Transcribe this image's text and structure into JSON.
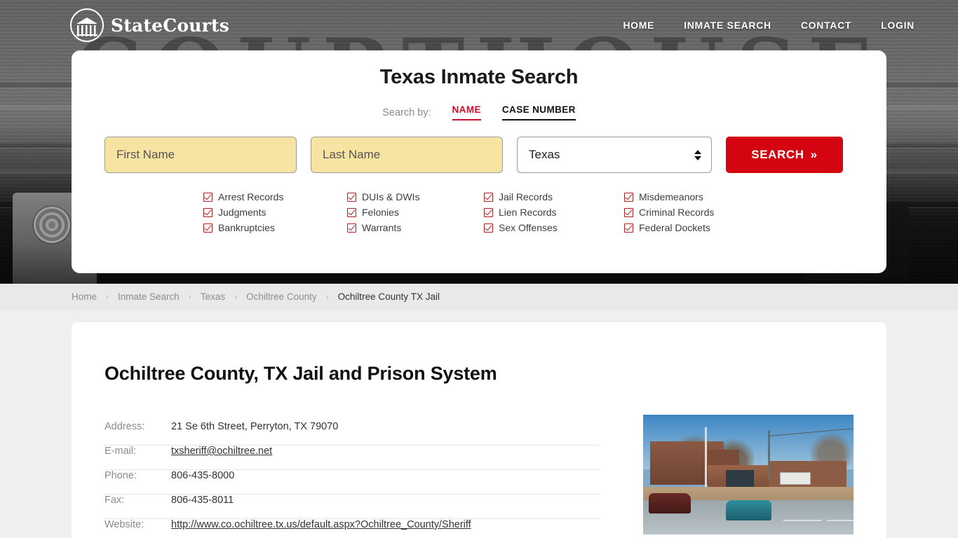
{
  "header": {
    "brand_name": "StateCourts",
    "logo_icon": "courthouse-circle-icon",
    "nav": [
      {
        "label": "HOME"
      },
      {
        "label": "INMATE SEARCH"
      },
      {
        "label": "CONTACT"
      },
      {
        "label": "LOGIN"
      }
    ]
  },
  "search_card": {
    "title": "Texas Inmate Search",
    "search_by_label": "Search by:",
    "tabs": [
      {
        "label": "NAME",
        "active": true
      },
      {
        "label": "CASE NUMBER",
        "active": false
      }
    ],
    "first_name_placeholder": "First Name",
    "first_name_value": "",
    "last_name_placeholder": "Last Name",
    "last_name_value": "",
    "state_value": "Texas",
    "search_button_label": "SEARCH",
    "search_button_chevron": "»",
    "record_types": [
      "Arrest Records",
      "DUIs & DWIs",
      "Jail Records",
      "Misdemeanors",
      "Judgments",
      "Felonies",
      "Lien Records",
      "Criminal Records",
      "Bankruptcies",
      "Warrants",
      "Sex Offenses",
      "Federal Dockets"
    ]
  },
  "breadcrumb": {
    "separator": "›",
    "items": [
      {
        "label": "Home",
        "current": false
      },
      {
        "label": "Inmate Search",
        "current": false
      },
      {
        "label": "Texas",
        "current": false
      },
      {
        "label": "Ochiltree County",
        "current": false
      },
      {
        "label": "Ochiltree County TX Jail",
        "current": true
      }
    ]
  },
  "page": {
    "title": "Ochiltree County, TX Jail and Prison System",
    "details": [
      {
        "label": "Address:",
        "value": "21 Se 6th Street, Perryton, TX 79070",
        "link": false
      },
      {
        "label": "E-mail:",
        "value": "txsheriff@ochiltree.net",
        "link": true
      },
      {
        "label": "Phone:",
        "value": "806-435-8000",
        "link": false
      },
      {
        "label": "Fax:",
        "value": "806-435-8011",
        "link": false
      },
      {
        "label": "Website:",
        "value": "http://www.co.ochiltree.tx.us/default.aspx?Ochiltree_County/Sheriff",
        "link": true
      }
    ],
    "photo_alt": "Ochiltree County jail building exterior"
  },
  "colors": {
    "accent_red": "#d40511",
    "tab_active_red": "#c8102e",
    "input_yellow": "#f8e4a2",
    "page_bg": "#efefef",
    "breadcrumb_bg": "#e9e9e9"
  },
  "hero": {
    "watermark_text": "COURTHOUSE"
  }
}
